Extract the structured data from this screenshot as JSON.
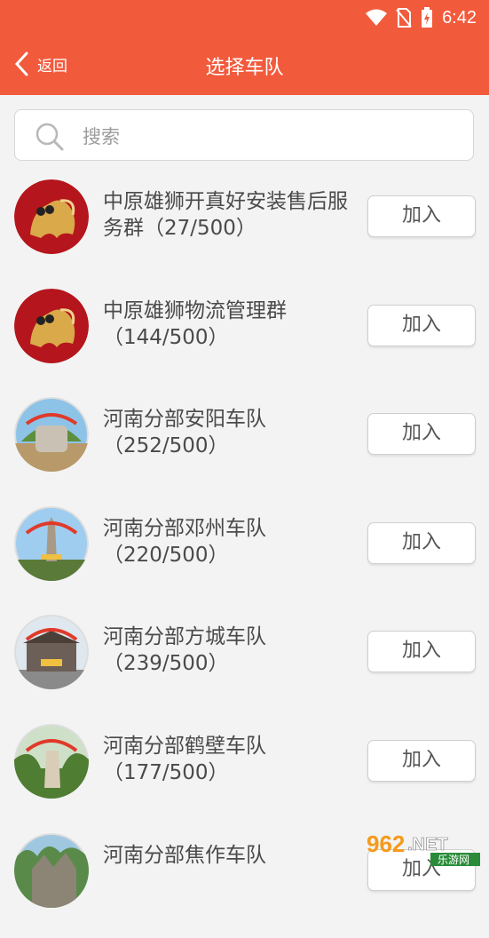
{
  "status_bar": {
    "time": "6:42"
  },
  "app_bar": {
    "back_label": "返回",
    "title": "选择车队"
  },
  "search": {
    "placeholder": "搜索"
  },
  "join_label": "加入",
  "teams": [
    {
      "name": "中原雄狮开真好安装售后服务群（27/500）",
      "avatar": "lion"
    },
    {
      "name": "中原雄狮物流管理群（144/500）",
      "avatar": "lion"
    },
    {
      "name": "河南分部安阳车队（252/500）",
      "avatar": "photo-stone"
    },
    {
      "name": "河南分部邓州车队（220/500）",
      "avatar": "photo-pagoda"
    },
    {
      "name": "河南分部方城车队（239/500）",
      "avatar": "photo-gate"
    },
    {
      "name": "河南分部鹤壁车队（177/500）",
      "avatar": "photo-monument"
    },
    {
      "name": "河南分部焦作车队",
      "avatar": "photo-rocks"
    }
  ],
  "watermark": {
    "brand": "962",
    "suffix": ".NET",
    "sub": "乐游网"
  },
  "colors": {
    "accent": "#f25a3c",
    "lion_bg": "#b5151c",
    "lion_gold": "#d9a94a"
  }
}
